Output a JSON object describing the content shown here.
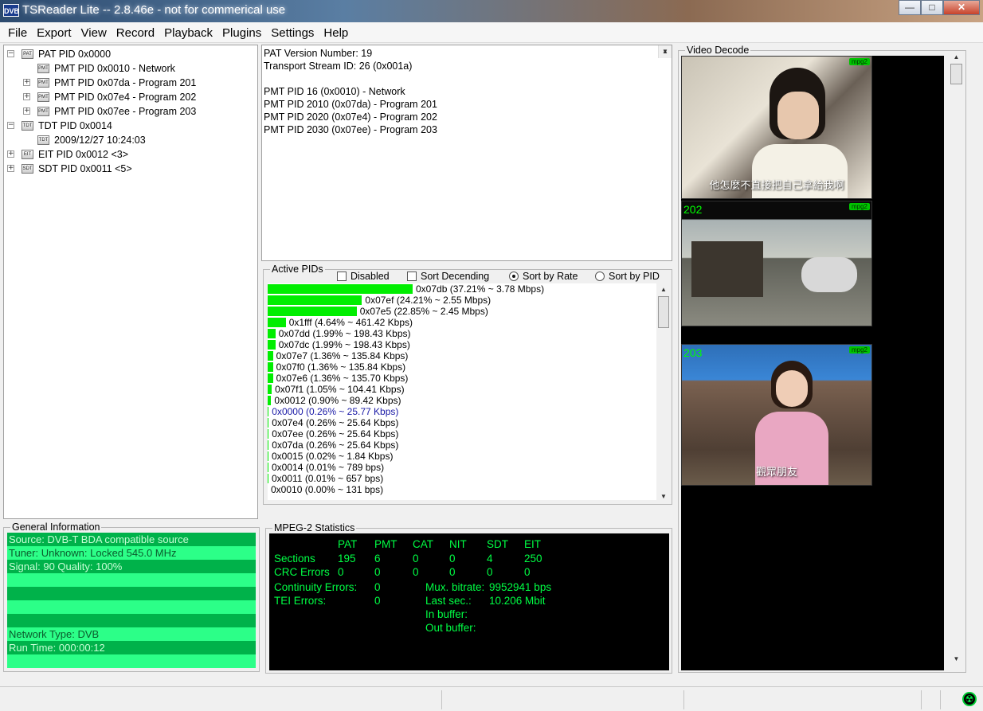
{
  "window": {
    "title": "TSReader Lite -- 2.8.46e - not for commerical use",
    "icon_text": "DVB"
  },
  "menu": [
    "File",
    "Export",
    "View",
    "Record",
    "Playback",
    "Plugins",
    "Settings",
    "Help"
  ],
  "tree": [
    {
      "label": "PAT PID 0x0000",
      "icon": "PAT",
      "level": 0,
      "expander": "minus"
    },
    {
      "label": "PMT PID 0x0010 - Network",
      "icon": "PMT",
      "level": 1,
      "expander": "none"
    },
    {
      "label": "PMT PID 0x07da - Program 201",
      "icon": "PMT",
      "level": 1,
      "expander": "plus"
    },
    {
      "label": "PMT PID 0x07e4 - Program 202",
      "icon": "PMT",
      "level": 1,
      "expander": "plus"
    },
    {
      "label": "PMT PID 0x07ee - Program 203",
      "icon": "PMT",
      "level": 1,
      "expander": "plus"
    },
    {
      "label": "TDT PID 0x0014",
      "icon": "TDT",
      "level": 0,
      "expander": "minus"
    },
    {
      "label": "2009/12/27 10:24:03",
      "icon": "TDT",
      "level": 1,
      "expander": "none"
    },
    {
      "label": "EIT PID 0x0012 <3>",
      "icon": "EIT",
      "level": 0,
      "expander": "plus"
    },
    {
      "label": "SDT PID 0x0011 <5>",
      "icon": "SDT",
      "level": 0,
      "expander": "plus"
    }
  ],
  "pat_info": [
    "PAT Version Number: 19",
    "Transport Stream ID: 26 (0x001a)",
    "",
    "PMT PID 16 (0x0010) - Network",
    "PMT PID 2010 (0x07da) - Program 201",
    "PMT PID 2020 (0x07e4) - Program 202",
    "PMT PID 2030 (0x07ee) - Program 203"
  ],
  "active_pids": {
    "title": "Active PIDs",
    "options": {
      "disabled": "Disabled",
      "sort_descending": "Sort Decending",
      "sort_by_rate": "Sort by Rate",
      "sort_by_pid": "Sort by PID"
    },
    "selected_sort": "Sort by Rate",
    "bar_color": "#00ee00",
    "selected_color": "#1a1aa6",
    "rows": [
      {
        "text": "0x07db (37.21% ~ 3.78 Mbps)",
        "percent": 37.21
      },
      {
        "text": "0x07ef (24.21% ~ 2.55 Mbps)",
        "percent": 24.21
      },
      {
        "text": "0x07e5 (22.85% ~ 2.45 Mbps)",
        "percent": 22.85
      },
      {
        "text": "0x1fff (4.64% ~ 461.42 Kbps)",
        "percent": 4.64
      },
      {
        "text": "0x07dd (1.99% ~ 198.43 Kbps)",
        "percent": 1.99
      },
      {
        "text": "0x07dc (1.99% ~ 198.43 Kbps)",
        "percent": 1.99
      },
      {
        "text": "0x07e7 (1.36% ~ 135.84 Kbps)",
        "percent": 1.36
      },
      {
        "text": "0x07f0 (1.36% ~ 135.84 Kbps)",
        "percent": 1.36
      },
      {
        "text": "0x07e6 (1.36% ~ 135.70 Kbps)",
        "percent": 1.36
      },
      {
        "text": "0x07f1 (1.05% ~ 104.41 Kbps)",
        "percent": 1.05
      },
      {
        "text": "0x0012 (0.90% ~ 89.42 Kbps)",
        "percent": 0.9
      },
      {
        "text": "0x0000 (0.26% ~ 25.77 Kbps)",
        "percent": 0.26,
        "selected": true
      },
      {
        "text": "0x07e4 (0.26% ~ 25.64 Kbps)",
        "percent": 0.26
      },
      {
        "text": "0x07ee (0.26% ~ 25.64 Kbps)",
        "percent": 0.26
      },
      {
        "text": "0x07da (0.26% ~ 25.64 Kbps)",
        "percent": 0.26
      },
      {
        "text": "0x0015 (0.02% ~ 1.84 Kbps)",
        "percent": 0.02
      },
      {
        "text": "0x0014 (0.01% ~ 789 bps)",
        "percent": 0.01
      },
      {
        "text": "0x0011 (0.01% ~ 657 bps)",
        "percent": 0.01
      },
      {
        "text": "0x0010 (0.00% ~ 131 bps)",
        "percent": 0.0
      }
    ]
  },
  "general": {
    "title": "General Information",
    "rows": [
      "Source: DVB-T BDA compatible source",
      "Tuner: Unknown: Locked 545.0 MHz",
      "Signal: 90 Quality: 100%",
      "",
      "",
      "",
      "",
      "Network Type: DVB",
      "Run Time: 000:00:12",
      ""
    ],
    "colors": {
      "dark": "#00b24a",
      "light": "#2cff88"
    }
  },
  "mpeg": {
    "title": "MPEG-2 Statistics",
    "headers": [
      "PAT",
      "PMT",
      "CAT",
      "NIT",
      "SDT",
      "EIT"
    ],
    "sections_label": "Sections",
    "sections": [
      "195",
      "6",
      "0",
      "0",
      "4",
      "250"
    ],
    "crc_label": "CRC Errors",
    "crc": [
      "0",
      "0",
      "0",
      "0",
      "0",
      "0"
    ],
    "continuity_label": "Continuity Errors:",
    "continuity": "0",
    "tei_label": "TEI Errors:",
    "tei": "0",
    "mux_label": "Mux. bitrate:",
    "mux": "9952941 bps",
    "last_label": "Last sec.:",
    "last": "10.206 Mbit",
    "in_buffer": "In buffer:",
    "out_buffer": "Out buffer:",
    "text_color": "#00ff44"
  },
  "video": {
    "title": "Video Decode",
    "thumbs": [
      {
        "channel": "",
        "badge": "mpg2",
        "caption": "他怎麼不直接把自己拿給我啊"
      },
      {
        "channel": "202",
        "badge": "mpg2",
        "caption": ""
      },
      {
        "channel": "203",
        "badge": "mpg2",
        "caption": "觀眾朋友"
      }
    ]
  }
}
